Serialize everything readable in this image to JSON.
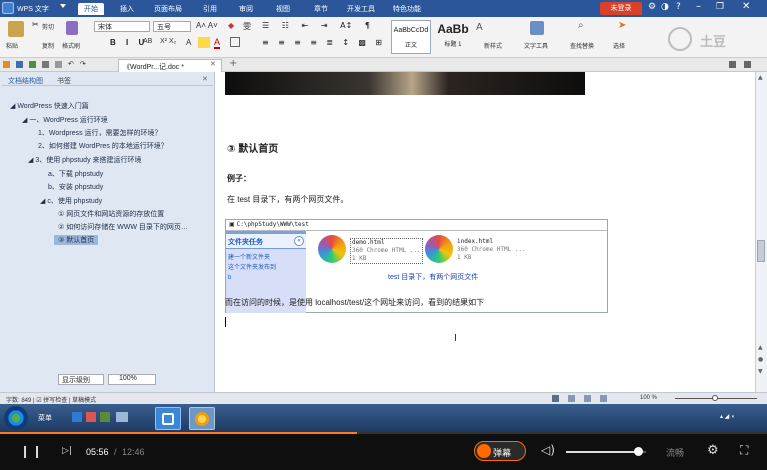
{
  "titlebar": {
    "app_name": "WPS 文字",
    "tabs": [
      "开始",
      "插入",
      "页面布局",
      "引用",
      "审阅",
      "视图",
      "章节",
      "开发工具",
      "特色功能"
    ],
    "user_button": "未登录"
  },
  "ribbon": {
    "clipboard": {
      "paste": "粘贴",
      "cut": "剪切",
      "copy": "复制",
      "format_painter": "格式刷"
    },
    "font_name": "宋体",
    "font_size": "五号",
    "styles": [
      {
        "preview": "AaBbCcDd",
        "name": "正文"
      },
      {
        "preview": "AaBb",
        "name": "标题 1"
      }
    ],
    "new_style": "新样式",
    "text_tools": "文字工具",
    "find_replace": "查找替换",
    "select": "选择",
    "logo_text": "土豆"
  },
  "doctab": {
    "name": "《WordPr...记.doc *"
  },
  "navpane": {
    "tabs": [
      "文档结构图",
      "书签"
    ],
    "items": [
      {
        "label": "WordPress 快速入门篇",
        "level": 0
      },
      {
        "label": "一、WordPress 运行环境",
        "level": 1
      },
      {
        "label": "1、Wordpress 运行，需要怎样的环境？",
        "level": 2
      },
      {
        "label": "2、如何搭建 WordPres 的本地运行环境？",
        "level": 2
      },
      {
        "label": "3、使用 phpstudy 来搭建运行环境",
        "level": 2
      },
      {
        "label": "a、下载 phpstudy",
        "level": 3
      },
      {
        "label": "b、安装 phpstudy",
        "level": 3
      },
      {
        "label": "c、使用 phpstudy",
        "level": 3
      },
      {
        "label": "① 网页文件和网站资源的存放位置",
        "level": 4
      },
      {
        "label": "② 如何访问存储在 WWW 目录下的网页…",
        "level": 4
      },
      {
        "label": "③ 默认首页",
        "level": 4,
        "selected": true
      }
    ],
    "show_level": "显示级别",
    "zoom": "100%"
  },
  "document": {
    "heading": "③ 默认首页",
    "example_label": "例子：",
    "para1": "在 test 目录下，有两个网页文件。",
    "screenshot": {
      "path": "C:\\phpStudy\\WWW\\test",
      "task_title": "文件夹任务",
      "tasks": [
        "建一个新文件夹",
        "这个文件夹发布到",
        "b"
      ],
      "files": [
        {
          "name": "demo.html",
          "type": "360 Chrome HTML ...",
          "size": "1 KB"
        },
        {
          "name": "index.html",
          "type": "360 Chrome HTML ...",
          "size": "1 KB"
        }
      ],
      "caption": "test 目录下，有两个网页文件"
    },
    "para2": "而在访问的时候，是使用 localhost/test/这个网址来访问，看到的结果如下"
  },
  "statusbar": {
    "left": "字数: 849 | ☑ 拼写检查 | 草稿模式",
    "zoom": "100 %"
  },
  "taskbar": {
    "start": "菜单"
  },
  "player": {
    "current_time": "05:56",
    "total_time": "12:46",
    "danmaku": "弹幕",
    "quality": "流畅",
    "progress": 0.465,
    "volume": 0.9
  },
  "colors": {
    "title_blue": "#2b579a",
    "nav_bg": "#dfe8f2",
    "player_bg": "#0f0f0f",
    "danmaku_orange": "#ff6a00",
    "progress_orange": "#ff7a1a"
  }
}
